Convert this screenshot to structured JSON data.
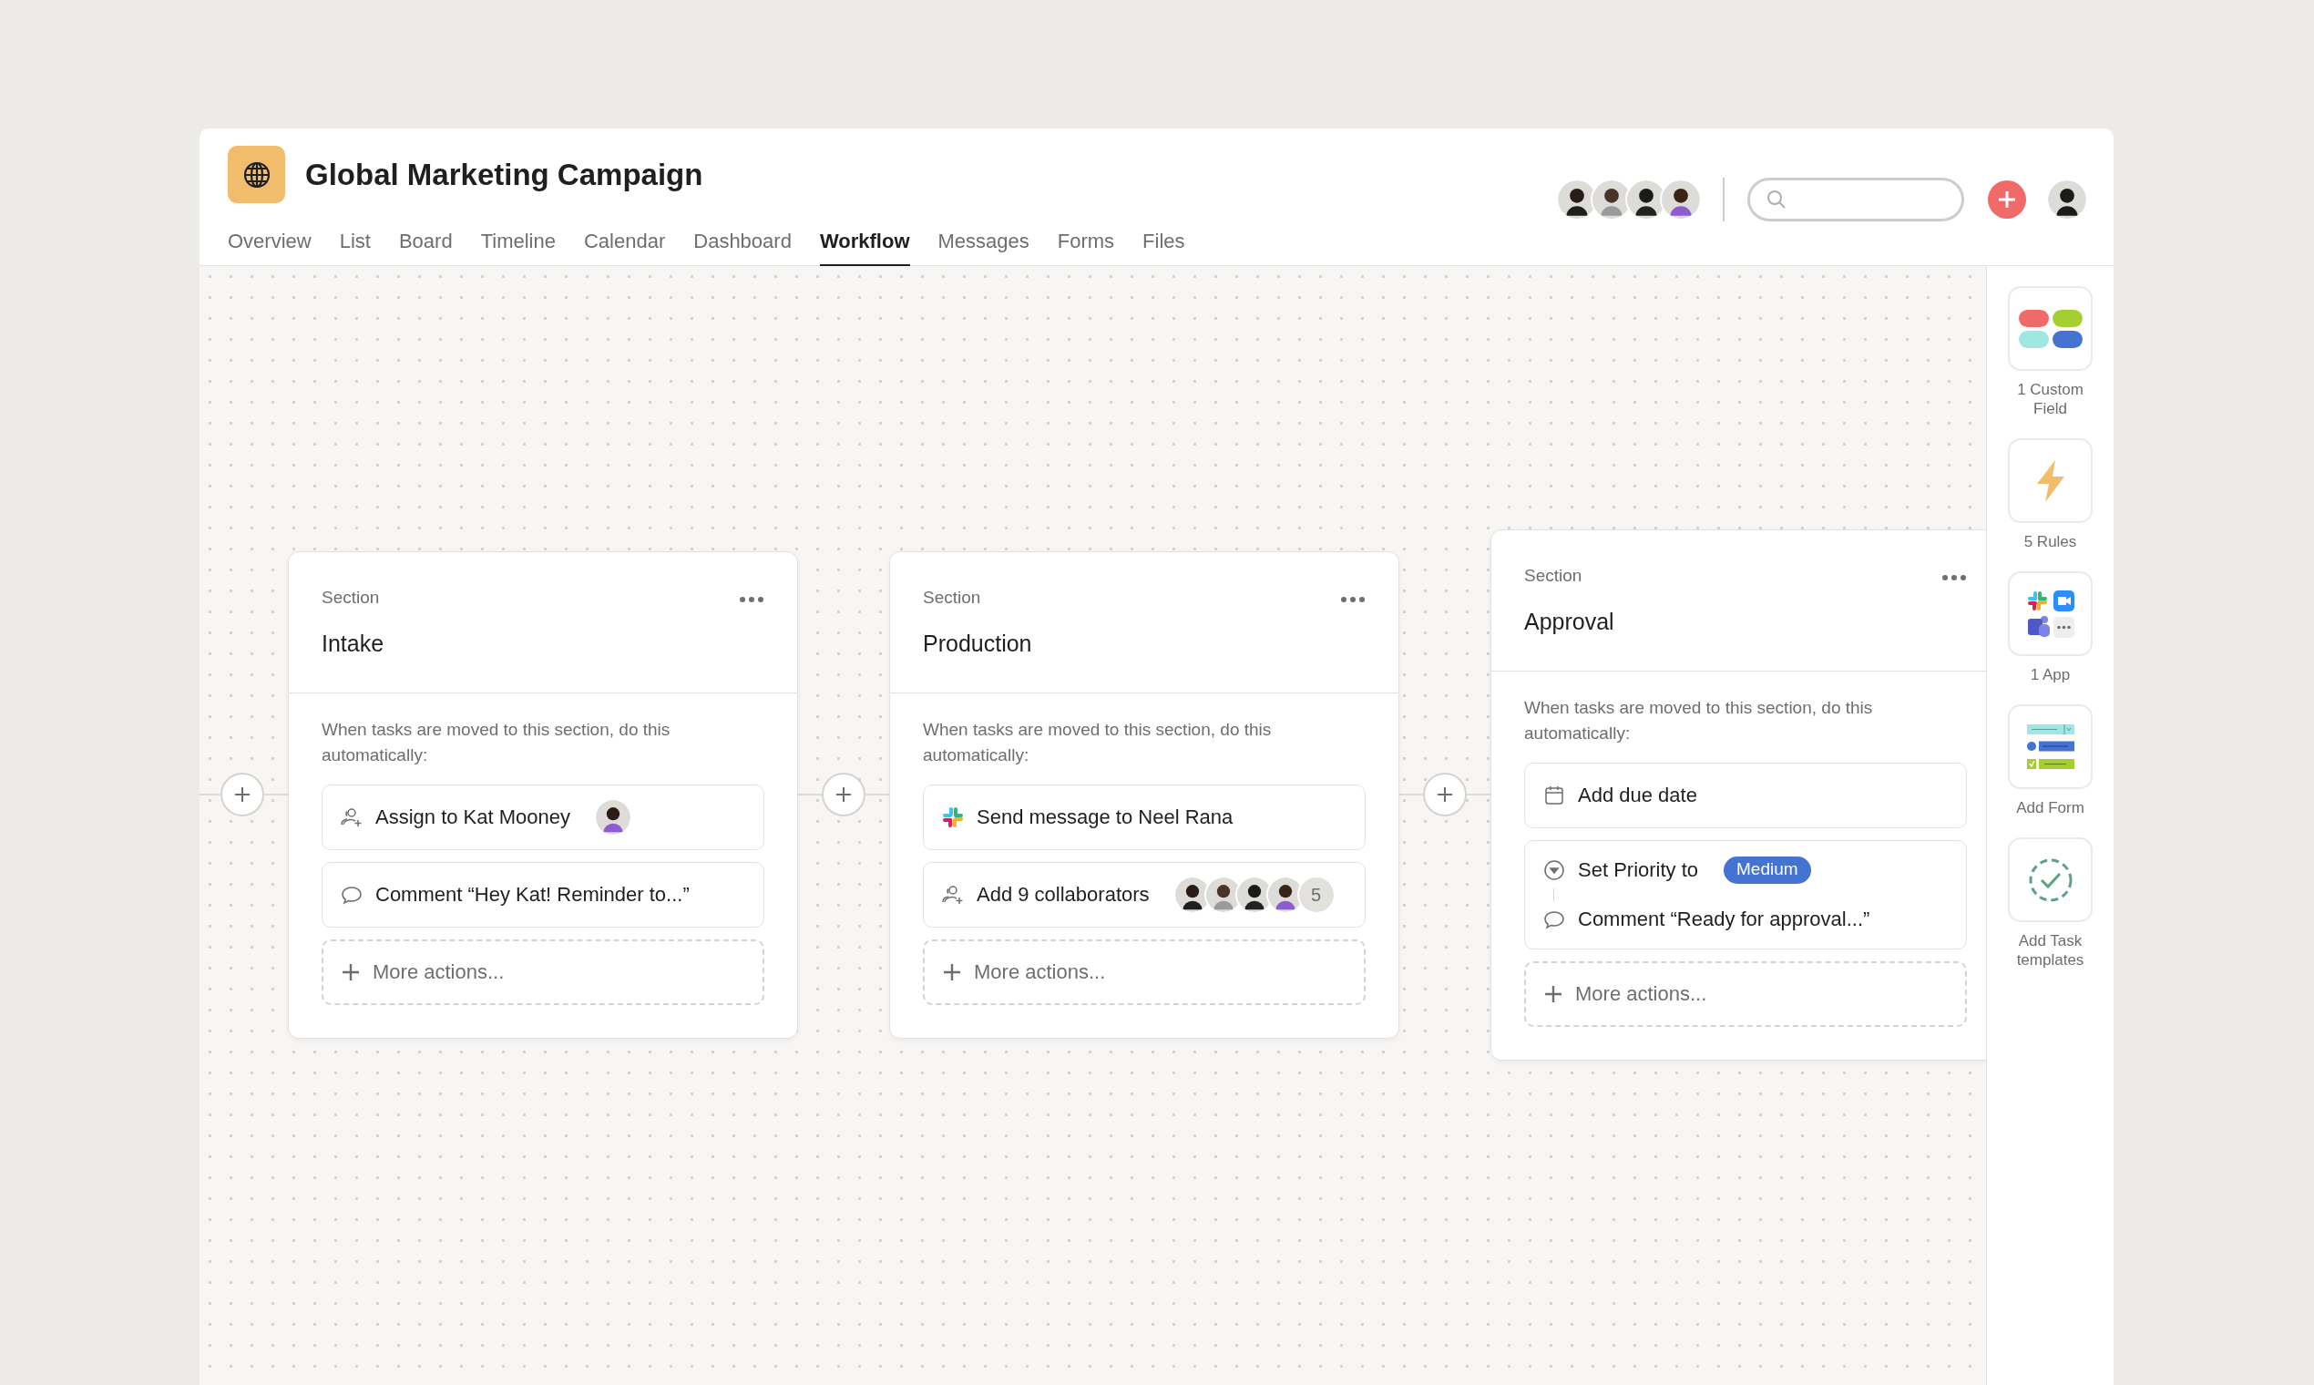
{
  "project": {
    "title": "Global Marketing Campaign"
  },
  "tabs": [
    {
      "label": "Overview",
      "selected": false
    },
    {
      "label": "List",
      "selected": false
    },
    {
      "label": "Board",
      "selected": false
    },
    {
      "label": "Timeline",
      "selected": false
    },
    {
      "label": "Calendar",
      "selected": false
    },
    {
      "label": "Dashboard",
      "selected": false
    },
    {
      "label": "Workflow",
      "selected": true
    },
    {
      "label": "Messages",
      "selected": false
    },
    {
      "label": "Forms",
      "selected": false
    },
    {
      "label": "Files",
      "selected": false
    }
  ],
  "sections": [
    {
      "label": "Section",
      "title": "Intake",
      "description": "When tasks are moved to this section, do this automatically:",
      "actions": [
        {
          "kind": "assign",
          "text": "Assign to Kat Mooney"
        },
        {
          "kind": "comment",
          "text": "Comment “Hey Kat! Reminder to...”"
        }
      ],
      "more": "More actions..."
    },
    {
      "label": "Section",
      "title": "Production",
      "description": "When tasks are moved to this section, do this automatically:",
      "actions": [
        {
          "kind": "slack",
          "text": "Send message to Neel Rana"
        },
        {
          "kind": "collaborators",
          "text": "Add 9 collaborators",
          "count": "5"
        }
      ],
      "more": "More actions..."
    },
    {
      "label": "Section",
      "title": "Approval",
      "description": "When tasks are moved to this section, do this automatically:",
      "actions": [
        {
          "kind": "due_date",
          "text": "Add due date"
        },
        {
          "kind": "chain",
          "steps": [
            {
              "kind": "priority",
              "text": "Set Priority to",
              "tag": "Medium",
              "color": "#4573d2"
            },
            {
              "kind": "comment",
              "text": "Comment “Ready for approval...”"
            }
          ]
        }
      ],
      "more": "More actions..."
    }
  ],
  "sidebar": [
    {
      "kind": "custom_field",
      "label": "1 Custom Field"
    },
    {
      "kind": "rules",
      "label": "5 Rules"
    },
    {
      "kind": "apps",
      "label": "1 App"
    },
    {
      "kind": "form",
      "label": "Add Form"
    },
    {
      "kind": "templates",
      "label": "Add Task templates"
    }
  ]
}
